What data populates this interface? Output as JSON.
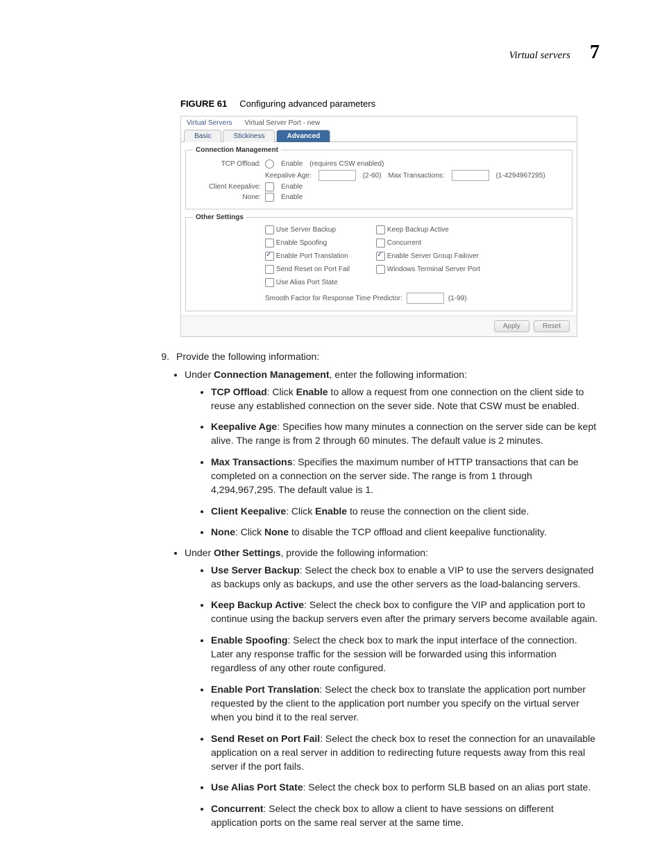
{
  "header": {
    "title": "Virtual servers",
    "chapter": "7"
  },
  "figure": {
    "label": "FIGURE 61",
    "caption": "Configuring advanced parameters"
  },
  "panel": {
    "crumb1": "Virtual Servers",
    "crumb2": "Virtual Server Port - new",
    "tabs": {
      "basic": "Basic",
      "stickiness": "Stickiness",
      "advanced": "Advanced"
    },
    "fs1": {
      "legend": "Connection Management",
      "tcp_offload_label": "TCP Offload:",
      "enable": "Enable",
      "requires": "(requires CSW enabled)",
      "keepalive_age_label": "Keepalive Age:",
      "keepalive_range": "(2-60)",
      "max_tx_label": "Max Transactions:",
      "max_tx_range": "(1-4294967295)",
      "client_keepalive_label": "Client Keepalive:",
      "none_label": "None:"
    },
    "fs2": {
      "legend": "Other Settings",
      "use_server_backup": "Use Server Backup",
      "keep_backup_active": "Keep Backup Active",
      "enable_spoofing": "Enable Spoofing",
      "concurrent": "Concurrent",
      "enable_port_translation": "Enable Port Translation",
      "enable_sg_failover": "Enable Server Group Failover",
      "send_reset": "Send Reset on Port Fail",
      "windows_ts": "Windows Terminal Server Port",
      "use_alias": "Use Alias Port State",
      "smooth_label": "Smooth Factor for Response Time Predictor:",
      "smooth_range": "(1-99)"
    },
    "buttons": {
      "apply": "Apply",
      "reset": "Reset"
    }
  },
  "step": {
    "num": "9.",
    "text": "Provide the following information:"
  },
  "lvl1": {
    "cm_intro_1": "Under ",
    "cm_intro_b": "Connection Management",
    "cm_intro_2": ", enter the following information:",
    "os_intro_1": "Under ",
    "os_intro_b": "Other Settings",
    "os_intro_2": ", provide the following information:"
  },
  "cm": {
    "tcp_b": "TCP Offload",
    "tcp_mid": ": Click ",
    "tcp_b2": "Enable",
    "tcp_rest": " to allow a request from one connection on the client side to reuse any established connection on the sever side. Note that CSW must be enabled.",
    "ka_b": "Keepalive Age",
    "ka_rest": ": Specifies how many minutes a connection on the server side can be kept alive. The range is from 2 through 60 minutes. The default value is 2 minutes.",
    "mt_b": "Max Transactions",
    "mt_rest": ": Specifies the maximum number of HTTP transactions that can be completed on a connection on the server side. The range is from 1 through 4,294,967,295. The default value is 1.",
    "ck_b": "Client Keepalive",
    "ck_mid": ": Click ",
    "ck_b2": "Enable",
    "ck_rest": " to reuse the connection on the client side.",
    "none_b": "None",
    "none_mid": ": Click ",
    "none_b2": "None",
    "none_rest": " to disable the TCP offload and client keepalive functionality."
  },
  "os": {
    "usb_b": "Use Server Backup",
    "usb_rest": ": Select the check box to enable a VIP to use the servers designated as backups only as backups, and use the other servers as the load-balancing servers.",
    "kba_b": "Keep Backup Active",
    "kba_rest": ": Select the check box to configure the VIP and application port to continue using the backup servers even after the primary servers become available again.",
    "es_b": "Enable Spoofing",
    "es_rest": ": Select the check box to mark the input interface of the connection. Later any response traffic for the session will be forwarded using this information regardless of any other route configured.",
    "ept_b": "Enable Port Translation",
    "ept_rest": ": Select the check box to translate the application port number requested by the client to the application port number you specify on the virtual server when you bind it to the real server.",
    "sr_b": "Send Reset on Port Fail",
    "sr_rest": ": Select the check box to reset the connection for an unavailable application on a real server in addition to redirecting future requests away from this real server if the port fails.",
    "uap_b": "Use Alias Port State",
    "uap_rest": ": Select the check box to perform SLB based on an alias port state.",
    "con_b": "Concurrent",
    "con_rest": ": Select the check box to allow a client to have sessions on different application ports on the same real server at the same time."
  }
}
